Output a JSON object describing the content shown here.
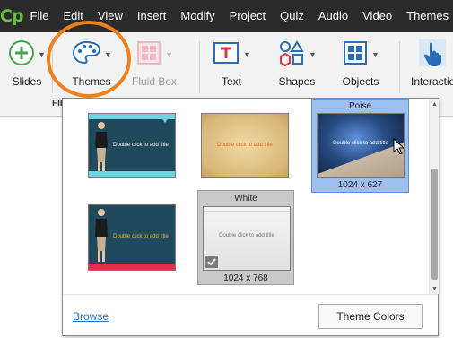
{
  "app": {
    "logo": "Cp"
  },
  "menubar": {
    "items": [
      {
        "label": "File"
      },
      {
        "label": "Edit"
      },
      {
        "label": "View"
      },
      {
        "label": "Insert"
      },
      {
        "label": "Modify"
      },
      {
        "label": "Project"
      },
      {
        "label": "Quiz"
      },
      {
        "label": "Audio"
      },
      {
        "label": "Video"
      },
      {
        "label": "Themes"
      }
    ]
  },
  "ribbon": {
    "buttons": {
      "slides": "Slides",
      "themes": "Themes",
      "fluid_box": "Fluid Box",
      "text": "Text",
      "shapes": "Shapes",
      "objects": "Objects",
      "interactions": "Interactions"
    },
    "group_label": "FIL",
    "icons": {
      "slides": "plus-circle-icon",
      "themes": "palette-icon",
      "fluid_box": "grid-box-icon",
      "text": "text-box-icon",
      "shapes": "shapes-icon",
      "objects": "objects-icon",
      "interactions": "hand-pointer-icon"
    }
  },
  "themes_panel": {
    "thumbnails": [
      {
        "caption": "Double click to add title"
      },
      {
        "caption": "Double click to add title"
      },
      {
        "name": "Poise",
        "caption": "Double click to add title",
        "size": "1024 x 627",
        "state": "selected"
      },
      {
        "caption": "Double click to add title"
      },
      {
        "name": "White",
        "caption": "Double click to add title",
        "size": "1024 x 768",
        "state": "hover",
        "check_icon": "checkmark-icon"
      }
    ],
    "footer": {
      "browse": "Browse",
      "theme_colors": "Theme Colors"
    }
  },
  "colors": {
    "menubar_bg": "#2b2b2b",
    "logo_green": "#66c23a",
    "highlight_orange": "#f07f1d",
    "selection_blue": "#9ec0ef",
    "link_blue": "#2f6fbf"
  }
}
